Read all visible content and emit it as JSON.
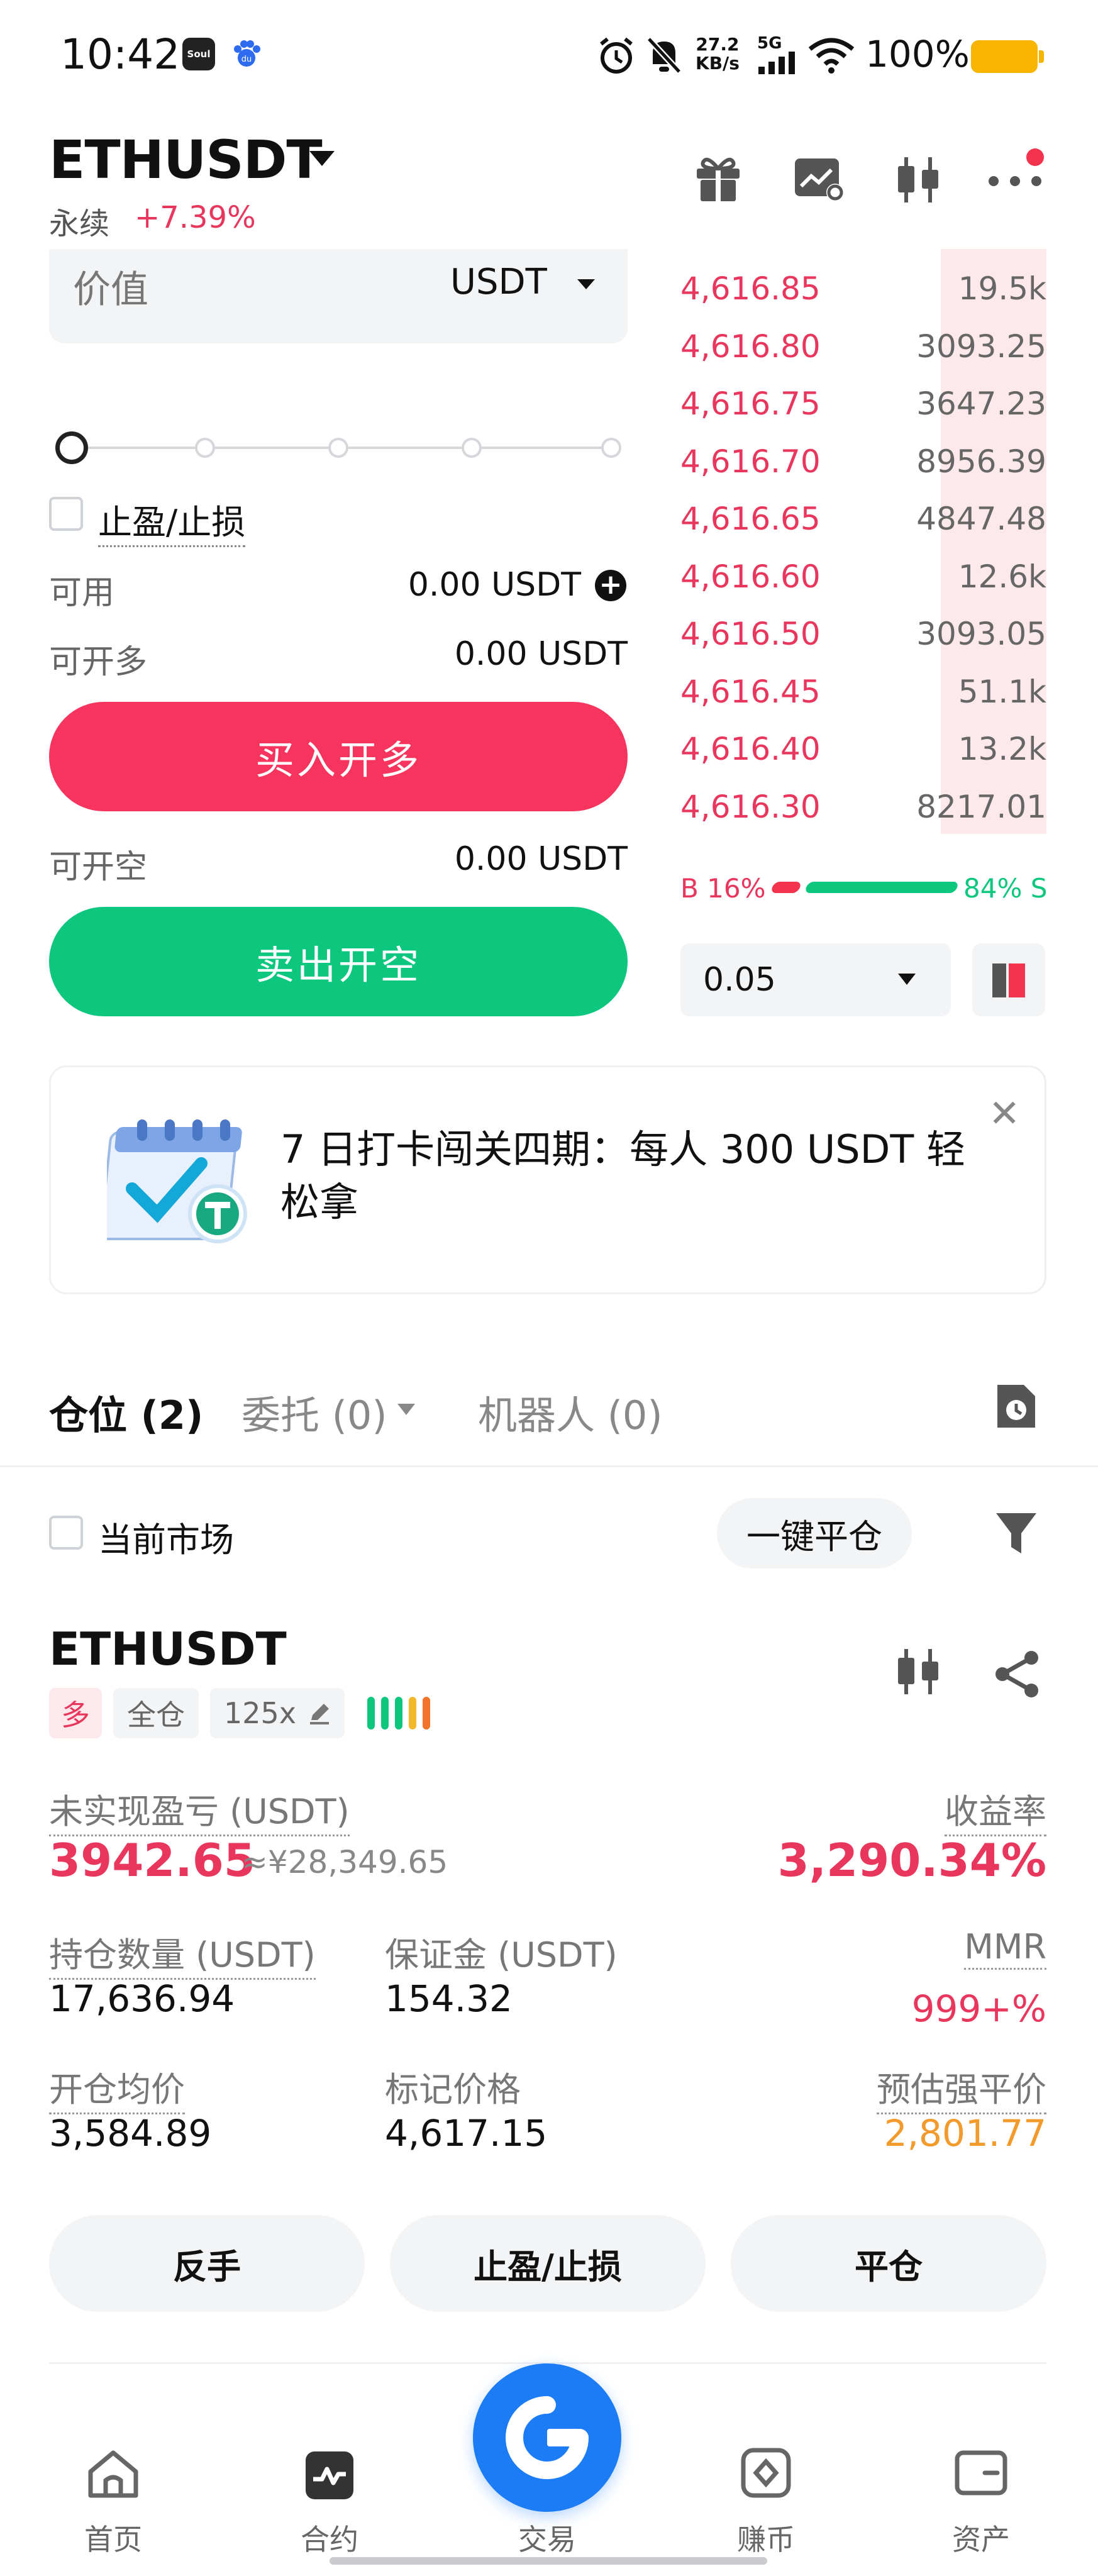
{
  "status_bar": {
    "time": "10:42",
    "app_badge_1": "Soul",
    "app_badge_2": "du",
    "net_speed_value": "27.2",
    "net_speed_unit": "KB/s",
    "network": "5G",
    "battery": "100%"
  },
  "header": {
    "symbol": "ETHUSDT",
    "contract_type": "永续",
    "change": "+7.39%"
  },
  "order_form": {
    "value_label": "价值",
    "value_unit": "USDT",
    "slider_percent": 0,
    "tpsl_label": "止盈/止损",
    "available_label": "可用",
    "available_value": "0.00 USDT",
    "can_long_label": "可开多",
    "can_long_value": "0.00 USDT",
    "buy_button": "买入开多",
    "can_short_label": "可开空",
    "can_short_value": "0.00 USDT",
    "sell_button": "卖出开空"
  },
  "order_book": {
    "asks": [
      {
        "price": "4,616.85",
        "qty": "19.5k"
      },
      {
        "price": "4,616.80",
        "qty": "3093.25"
      },
      {
        "price": "4,616.75",
        "qty": "3647.23"
      },
      {
        "price": "4,616.70",
        "qty": "8956.39"
      },
      {
        "price": "4,616.65",
        "qty": "4847.48"
      },
      {
        "price": "4,616.60",
        "qty": "12.6k"
      },
      {
        "price": "4,616.50",
        "qty": "3093.05"
      },
      {
        "price": "4,616.45",
        "qty": "51.1k"
      },
      {
        "price": "4,616.40",
        "qty": "13.2k"
      },
      {
        "price": "4,616.30",
        "qty": "8217.01"
      }
    ],
    "buy_ratio": "B 16%",
    "sell_ratio": "84% S",
    "buy_ratio_fraction": 0.16,
    "price_step": "0.05"
  },
  "banner": {
    "text": "7 日打卡闯关四期：每人 300 USDT 轻松拿"
  },
  "tabs": {
    "positions": "仓位 (2)",
    "orders": "委托 (0)",
    "bots": "机器人 (0)"
  },
  "filters": {
    "current_market": "当前市场",
    "close_all": "一键平仓"
  },
  "position": {
    "symbol": "ETHUSDT",
    "side": "多",
    "margin_mode": "全仓",
    "leverage": "125x",
    "unrealized_pnl_label": "未实现盈亏 (USDT)",
    "unrealized_pnl": "3942.65",
    "unrealized_pnl_cny": "≈¥28,349.65",
    "roe_label": "收益率",
    "roe": "3,290.34%",
    "size_label": "持仓数量 (USDT)",
    "size": "17,636.94",
    "margin_label": "保证金 (USDT)",
    "margin": "154.32",
    "mmr_label": "MMR",
    "mmr": "999+%",
    "entry_label": "开仓均价",
    "entry": "3,584.89",
    "mark_label": "标记价格",
    "mark": "4,617.15",
    "liq_label": "预估强平价",
    "liq": "2,801.77",
    "reverse_button": "反手",
    "tpsl_button": "止盈/止损",
    "close_button": "平仓"
  },
  "bottom_nav": {
    "home": "首页",
    "futures": "合约",
    "trade": "交易",
    "earn": "赚币",
    "assets": "资产"
  },
  "colors": {
    "red": "#f7345e",
    "green": "#0dc77f",
    "blue": "#1b7cf5",
    "orange": "#f39a2c"
  }
}
